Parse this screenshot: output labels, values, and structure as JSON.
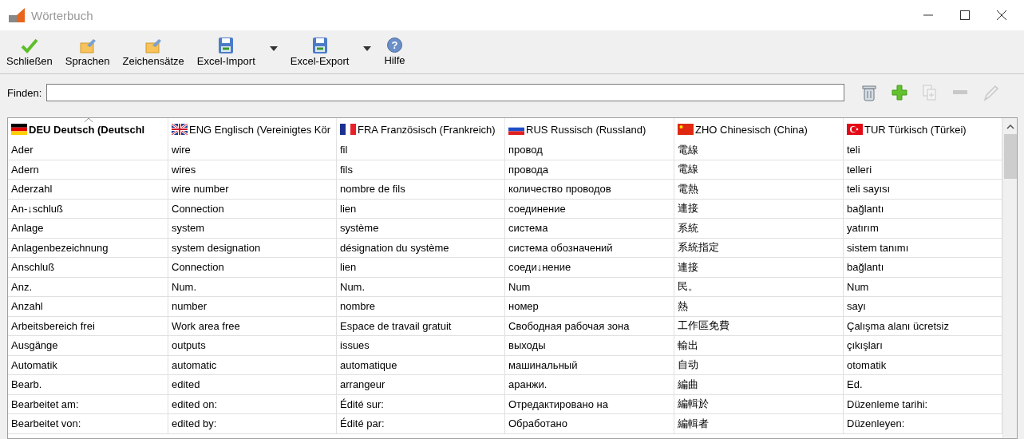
{
  "window": {
    "title": "Wörterbuch"
  },
  "toolbar": [
    {
      "label": "Schließen",
      "kind": "check",
      "has_menu": false
    },
    {
      "label": "Sprachen",
      "kind": "folder",
      "has_menu": false
    },
    {
      "label": "Zeichensätze",
      "kind": "folder",
      "has_menu": false
    },
    {
      "label": "Excel-Import",
      "kind": "disk",
      "has_menu": true
    },
    {
      "label": "Excel-Export",
      "kind": "disk",
      "has_menu": true
    },
    {
      "label": "Hilfe",
      "kind": "help",
      "glyph": "?",
      "has_menu": false
    }
  ],
  "search": {
    "label": "Finden:"
  },
  "actions": [
    {
      "kind": "trash",
      "disabled": false
    },
    {
      "kind": "add",
      "disabled": false
    },
    {
      "kind": "copy",
      "disabled": true
    },
    {
      "kind": "remove",
      "disabled": true
    },
    {
      "kind": "edit",
      "disabled": true
    }
  ],
  "table": {
    "columns": [
      {
        "label": "DEU Deutsch (Deutschl",
        "kind": "de",
        "sorted": true
      },
      {
        "label": "ENG Englisch (Vereinigtes Kör",
        "kind": "gb",
        "sorted": false
      },
      {
        "label": "FRA Französisch (Frankreich)",
        "kind": "fr",
        "sorted": false
      },
      {
        "label": "RUS Russisch (Russland)",
        "kind": "ru",
        "sorted": false
      },
      {
        "label": "ZHO Chinesisch (China)",
        "kind": "cn",
        "sorted": false
      },
      {
        "label": "TUR Türkisch (Türkei)",
        "kind": "tr",
        "sorted": false
      }
    ],
    "rows": [
      [
        "Ader",
        "wire",
        "fil",
        "провод",
        "電線",
        "teli"
      ],
      [
        "Adern",
        "wires",
        "fils",
        "провода",
        "電線",
        "telleri"
      ],
      [
        "Aderzahl",
        "wire number",
        "nombre de fils",
        "количество проводов",
        "電熱",
        "teli sayısı"
      ],
      [
        "An-↓schluß",
        "Connection",
        "lien",
        "соединение",
        "連接",
        "bağlantı"
      ],
      [
        "Anlage",
        "system",
        "système",
        "система",
        "系統",
        "yatırım"
      ],
      [
        "Anlagenbezeichnung",
        "system designation",
        "désignation du système",
        "система обозначений",
        "系統指定",
        "sistem tanımı"
      ],
      [
        "Anschluß",
        "Connection",
        "lien",
        "соеди↓нение",
        "連接",
        "bağlantı"
      ],
      [
        "Anz.",
        "Num.",
        "Num.",
        "Num",
        "民。",
        "Num"
      ],
      [
        "Anzahl",
        "number",
        "nombre",
        "номер",
        "熱",
        "sayı"
      ],
      [
        "Arbeitsbereich frei",
        "Work area free",
        "Espace de travail gratuit",
        "Свободная рабочая зона",
        "工作區免費",
        "Çalışma alanı ücretsiz"
      ],
      [
        "Ausgänge",
        "outputs",
        "issues",
        "выходы",
        "輸出",
        "çıkışları"
      ],
      [
        "Automatik",
        "automatic",
        "automatique",
        "машинальный",
        "自动",
        "otomatik"
      ],
      [
        "Bearb.",
        "edited",
        "arrangeur",
        "аранжи.",
        "編曲",
        "Ed."
      ],
      [
        "Bearbeitet am:",
        "edited on:",
        "Édité sur:",
        "Отредактировано на",
        "編輯於",
        "Düzenleme tarihi:"
      ],
      [
        "Bearbeitet von:",
        "edited by:",
        "Édité par:",
        "Обработано",
        "編輯者",
        "Düzenleyen:"
      ]
    ]
  }
}
